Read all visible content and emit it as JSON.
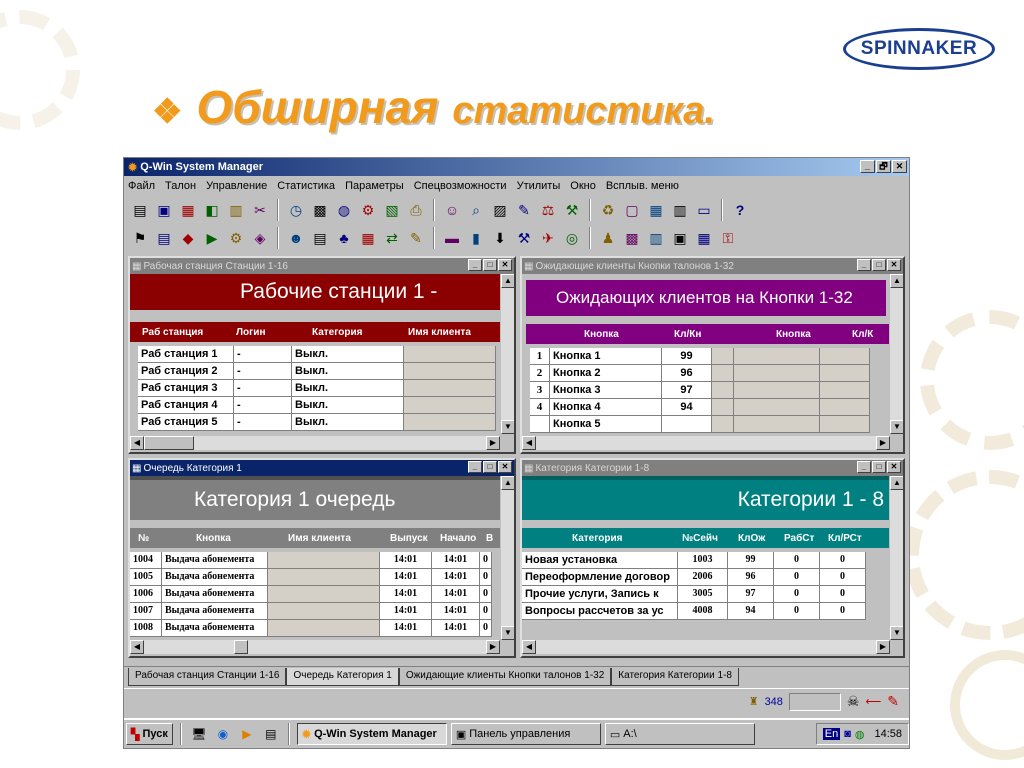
{
  "slide": {
    "logo": "SPINNAKER",
    "bullet": "❖",
    "title_word1": "Обширная",
    "title_word2": "статистика."
  },
  "app": {
    "title": "Q-Win System Manager",
    "window_buttons": [
      "_",
      "🗗",
      "✕"
    ],
    "menu": [
      "Файл",
      "Талон",
      "Управление",
      "Статистика",
      "Параметры",
      "Спецвозможности",
      "Утилиты",
      "Окно",
      "Всплыв. меню"
    ],
    "toolbar1_icons": [
      "print-icon",
      "monitor-icon",
      "network-icon",
      "chart-icon",
      "calendar-icon",
      "tools-icon",
      "clock-icon",
      "calendar-date-icon",
      "globe-icon",
      "settings-icon",
      "report-icon",
      "printer-icon",
      "people-icon",
      "search-icon",
      "building-icon",
      "pencil-icon",
      "scale-icon",
      "tools2-icon",
      "recycle-icon",
      "window-icon",
      "layout-icon",
      "grid-icon",
      "display-icon",
      "help-icon"
    ],
    "toolbar2_icons": [
      "flag-icon",
      "book-icon",
      "diamond-icon",
      "folder-icon",
      "gear-icon",
      "tag-icon",
      "users-icon",
      "list-icon",
      "tree-icon",
      "table-icon",
      "connect-icon",
      "edit-icon",
      "color-icon",
      "bars-icon",
      "download-icon",
      "tools3-icon",
      "send-icon",
      "disc-icon",
      "person-icon",
      "grid2-icon",
      "report2-icon",
      "color2-icon",
      "calc-icon",
      "key-icon"
    ],
    "help_glyph": "?"
  },
  "workstations": {
    "window_title": "Рабочая станция Станции 1-16",
    "banner": "Рабочие станции 1 -",
    "colors": {
      "banner": "#8b0000",
      "header": "#8b0000"
    },
    "headers": [
      "Раб станция",
      "Логин",
      "Категория",
      "Имя клиента"
    ],
    "rows": [
      [
        "Раб станция 1",
        "-",
        "Выкл.",
        ""
      ],
      [
        "Раб станция 2",
        "-",
        "Выкл.",
        ""
      ],
      [
        "Раб станция 3",
        "-",
        "Выкл.",
        ""
      ],
      [
        "Раб станция 4",
        "-",
        "Выкл.",
        ""
      ],
      [
        "Раб станция 5",
        "-",
        "Выкл.",
        ""
      ]
    ]
  },
  "waiting": {
    "window_title": "Ожидающие клиенты Кнопки талонов 1-32",
    "banner": "Ожидающих клиентов на Кнопки 1-32",
    "colors": {
      "banner": "#800080",
      "header": "#800080"
    },
    "headers": [
      "Кнопка",
      "Кл/Кн",
      "Кнопка",
      "Кл/К"
    ],
    "rows": [
      [
        "1",
        "Кнопка 1",
        "99",
        "",
        "",
        ""
      ],
      [
        "2",
        "Кнопка 2",
        "96",
        "",
        "",
        ""
      ],
      [
        "3",
        "Кнопка 3",
        "97",
        "",
        "",
        ""
      ],
      [
        "4",
        "Кнопка 4",
        "94",
        "",
        "",
        ""
      ],
      [
        "",
        "Кнопка 5",
        "",
        "",
        "",
        ""
      ]
    ]
  },
  "queue": {
    "window_title": "Очередь Категория 1",
    "banner": "Категория 1 очередь",
    "colors": {
      "banner": "#808080",
      "header": "#808080"
    },
    "headers": [
      "№",
      "Кнопка",
      "Имя клиента",
      "Выпуск",
      "Начало",
      "В"
    ],
    "rows": [
      [
        "1004",
        "Выдача абонемента",
        "",
        "14:01",
        "14:01",
        "0"
      ],
      [
        "1005",
        "Выдача абонемента",
        "",
        "14:01",
        "14:01",
        "0"
      ],
      [
        "1006",
        "Выдача абонемента",
        "",
        "14:01",
        "14:01",
        "0"
      ],
      [
        "1007",
        "Выдача абонемента",
        "",
        "14:01",
        "14:01",
        "0"
      ],
      [
        "1008",
        "Выдача абонемента",
        "",
        "14:01",
        "14:01",
        "0"
      ]
    ]
  },
  "categories": {
    "window_title": "Категория Категории 1-8",
    "banner": "Категории 1 - 8",
    "colors": {
      "banner": "#008080",
      "header": "#008080"
    },
    "headers": [
      "Категория",
      "№Сейч",
      "КлОж",
      "РабСт",
      "Кл/РСт"
    ],
    "rows": [
      [
        "Новая установка",
        "1003",
        "99",
        "0",
        "0"
      ],
      [
        "Переоформление договор",
        "2006",
        "96",
        "0",
        "0"
      ],
      [
        "Прочие услуги, Запись к",
        "3005",
        "97",
        "0",
        "0"
      ],
      [
        "Вопросы рассчетов за ус",
        "4008",
        "94",
        "0",
        "0"
      ]
    ]
  },
  "tabs": [
    "Рабочая станция Станции 1-16",
    "Очередь Категория 1",
    "Ожидающие клиенты Кнопки талонов 1-32",
    "Категория Категории 1-8"
  ],
  "status": {
    "count": "348"
  },
  "taskbar": {
    "start": "Пуск",
    "tasks": [
      "Q-Win System Manager",
      "Панель управления",
      "A:\\"
    ],
    "lang": "En",
    "time": "14:58"
  }
}
